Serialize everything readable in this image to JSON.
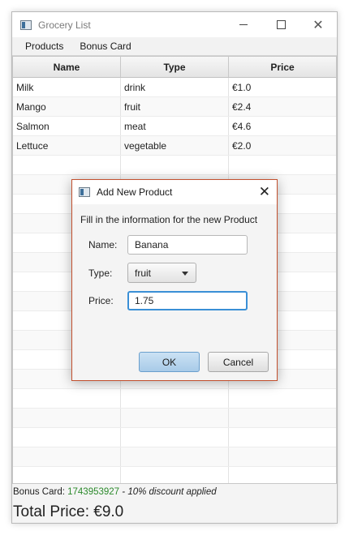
{
  "window": {
    "title": "Grocery List"
  },
  "menu": [
    "Products",
    "Bonus Card"
  ],
  "table": {
    "columns": [
      "Name",
      "Type",
      "Price"
    ],
    "rows": [
      [
        "Milk",
        "drink",
        "€1.0"
      ],
      [
        "Mango",
        "fruit",
        "€2.4"
      ],
      [
        "Salmon",
        "meat",
        "€4.6"
      ],
      [
        "Lettuce",
        "vegetable",
        "€2.0"
      ]
    ]
  },
  "status": {
    "bonus_prefix": "Bonus Card: ",
    "bonus_number": "1743953927",
    "bonus_note": " - 10% discount applied",
    "total": "Total Price: €9.0"
  },
  "dialog": {
    "title": "Add New Product",
    "header": "Fill in the information for the new Product",
    "name_label": "Name:",
    "name_value": "Banana",
    "type_label": "Type:",
    "type_value": "fruit",
    "price_label": "Price:",
    "price_value": "1.75",
    "ok_label": "OK",
    "cancel_label": "Cancel"
  }
}
